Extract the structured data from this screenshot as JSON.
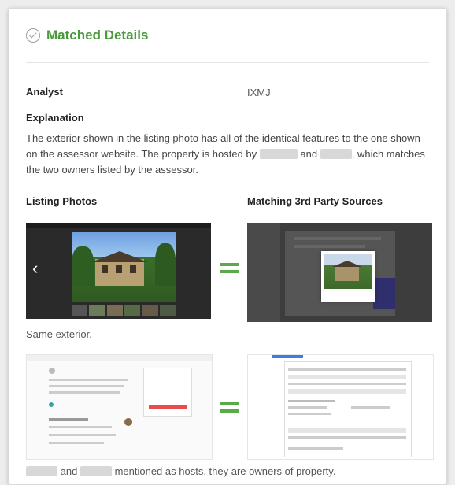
{
  "header": {
    "title": "Matched Details"
  },
  "analyst": {
    "label": "Analyst",
    "value": "IXMJ"
  },
  "explanation": {
    "label": "Explanation",
    "text_part1": "The exterior shown in the listing photo has all of the identical features to the one shown on the assessor website. The property is hosted by",
    "text_part2": "and",
    "text_part3": ", which matches the two owners listed by the assessor."
  },
  "columns": {
    "left": "Listing Photos",
    "right": "Matching 3rd Party Sources"
  },
  "matches": [
    {
      "caption": "Same exterior."
    },
    {
      "caption_part1": "and",
      "caption_part2": "mentioned as hosts, they are owners of property."
    }
  ],
  "colors": {
    "accent": "#4a9a3c",
    "equals": "#5aaa4a"
  }
}
